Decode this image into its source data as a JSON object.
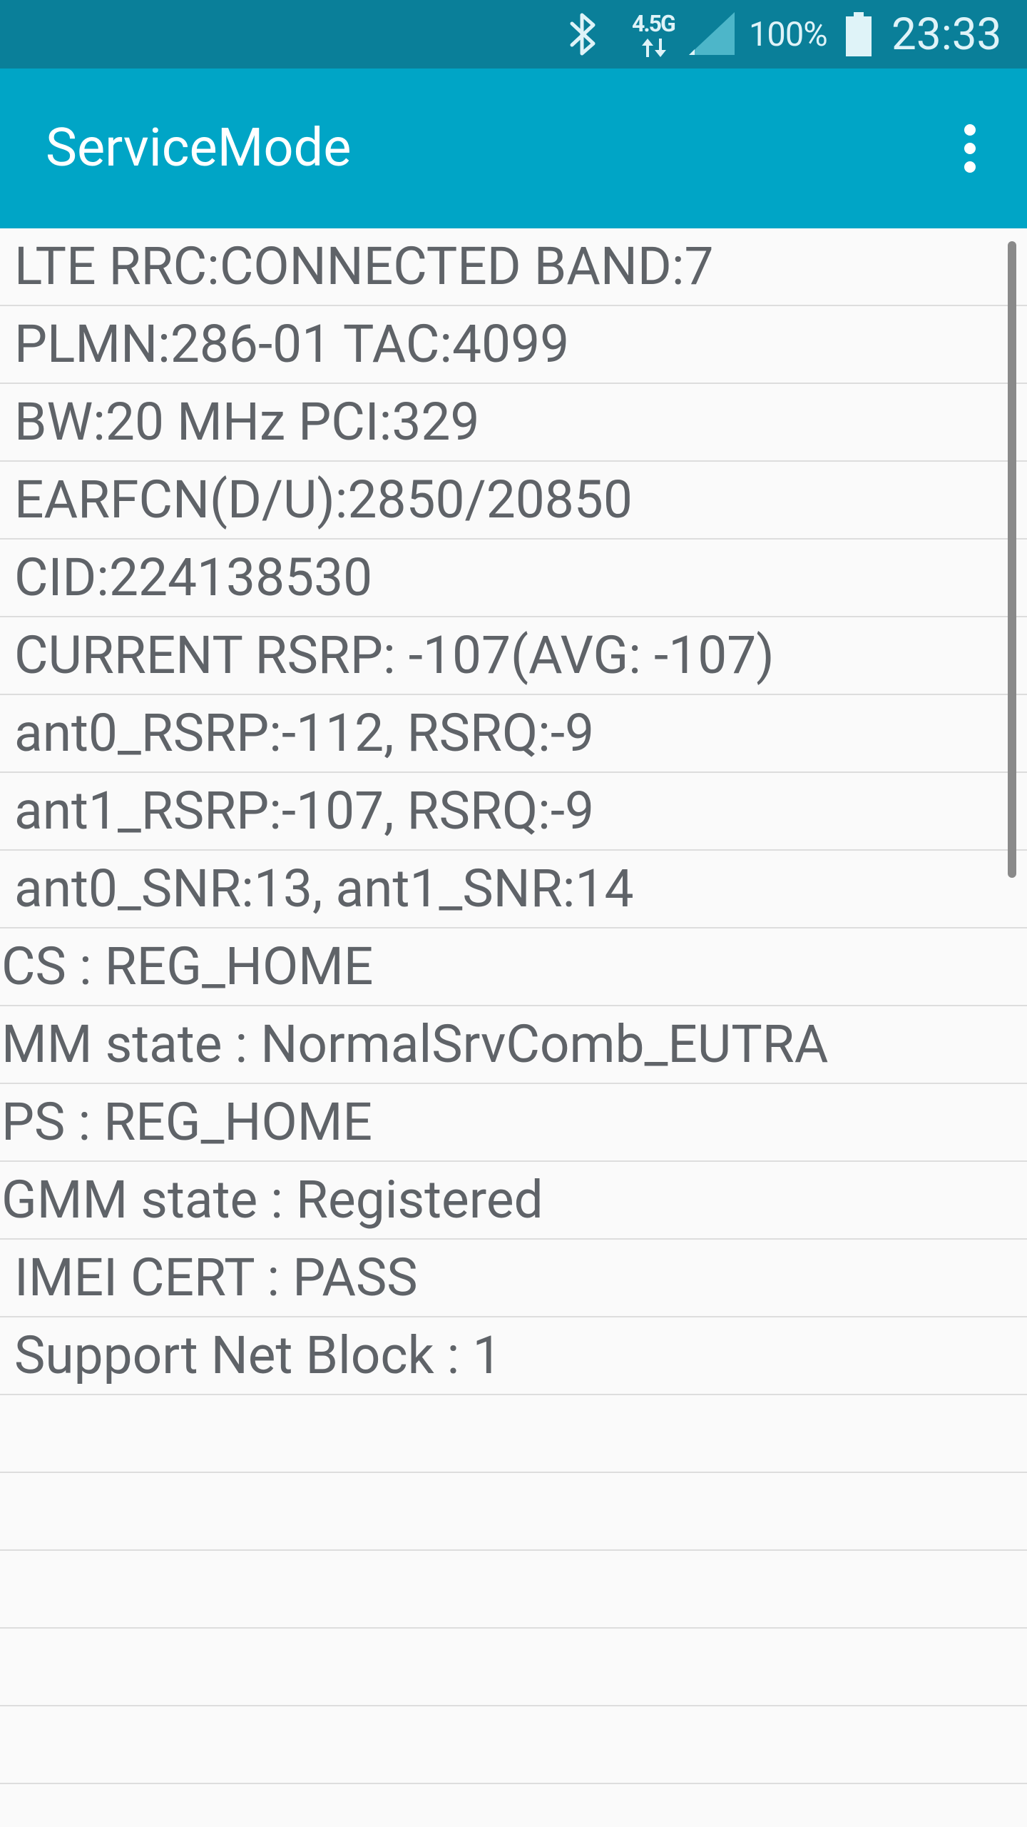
{
  "status_bar": {
    "network_type": "4.5G",
    "battery_percent": "100%",
    "time": "23:33",
    "icons": [
      "bluetooth-icon",
      "network-type-icon",
      "signal-icon",
      "battery-icon"
    ]
  },
  "app_bar": {
    "title": "ServiceMode",
    "menu_icon": "more-vert-icon"
  },
  "rows": [
    {
      "text": "LTE RRC:CONNECTED BAND:7",
      "indent": true
    },
    {
      "text": "PLMN:286-01 TAC:4099",
      "indent": true
    },
    {
      "text": "BW:20 MHz PCI:329",
      "indent": true
    },
    {
      "text": "EARFCN(D/U):2850/20850",
      "indent": true
    },
    {
      "text": "CID:224138530",
      "indent": true
    },
    {
      "text": "CURRENT RSRP: -107(AVG: -107)",
      "indent": true
    },
    {
      "text": "ant0_RSRP:-112, RSRQ:-9",
      "indent": true
    },
    {
      "text": "ant1_RSRP:-107, RSRQ:-9",
      "indent": true
    },
    {
      "text": "ant0_SNR:13, ant1_SNR:14",
      "indent": true
    },
    {
      "text": "CS : REG_HOME",
      "indent": false
    },
    {
      "text": "MM state : NormalSrvComb_EUTRA",
      "indent": false
    },
    {
      "text": "PS : REG_HOME",
      "indent": false
    },
    {
      "text": "GMM state : Registered",
      "indent": false
    },
    {
      "text": "IMEI CERT : PASS",
      "indent": true
    },
    {
      "text": "Support Net Block : 1",
      "indent": true
    },
    {
      "text": "",
      "indent": true
    },
    {
      "text": "",
      "indent": true
    },
    {
      "text": "",
      "indent": true
    },
    {
      "text": "",
      "indent": true
    },
    {
      "text": "",
      "indent": true
    },
    {
      "text": "",
      "indent": true
    }
  ],
  "colors": {
    "status_bar": "#0a7f99",
    "app_bar": "#00a5c6",
    "background": "#fafafa",
    "row_text": "#5f6368",
    "divider": "#dddddd"
  }
}
